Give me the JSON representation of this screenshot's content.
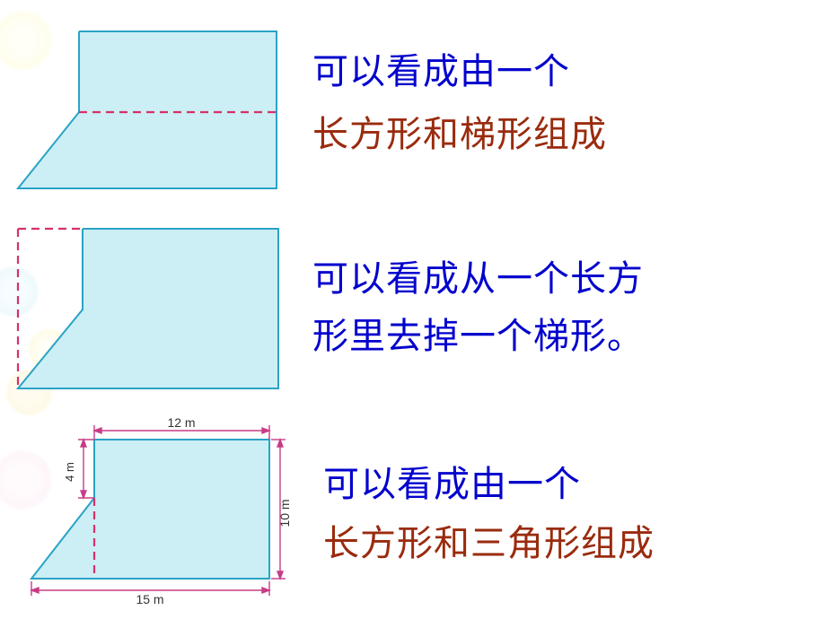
{
  "row1": {
    "line1": "可以看成由一个",
    "line2": "长方形和梯形组成"
  },
  "row2": {
    "line1": "可以看成从一个长方",
    "line2": "形里去掉一个梯形。"
  },
  "row3": {
    "line1": "可以看成由一个",
    "line2": "长方形和三角形组成",
    "dim_top": "12 m",
    "dim_right": "10 m",
    "dim_bottom": "15 m",
    "dim_left": "4 m"
  }
}
